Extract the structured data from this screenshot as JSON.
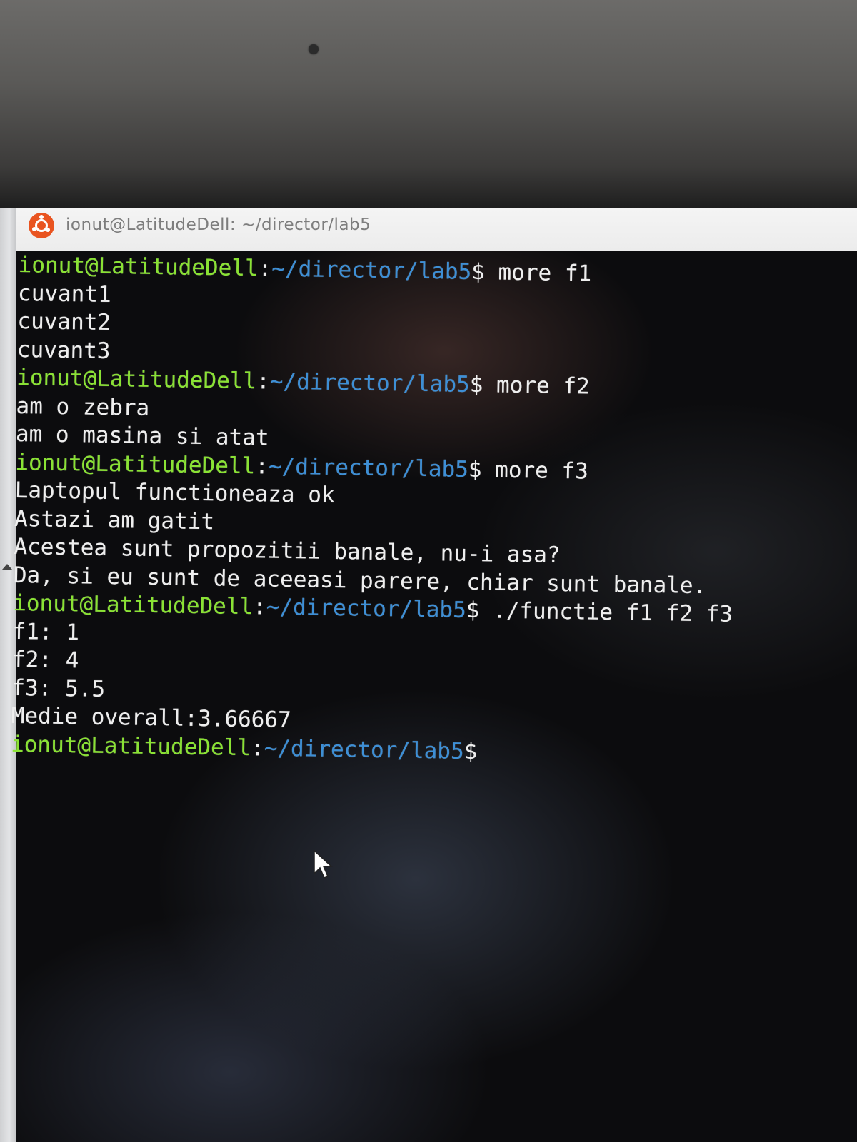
{
  "window": {
    "title": "ionut@LatitudeDell: ~/director/lab5",
    "icon": "ubuntu-icon"
  },
  "prompt": {
    "user_host": "ionut@LatitudeDell",
    "colon": ":",
    "path": "~/director/lab5",
    "dollar": "$"
  },
  "colors": {
    "user_host": "#8ae234",
    "path": "#3d8fd6",
    "output": "#eeeeee"
  },
  "terminal": {
    "lines": [
      {
        "type": "prompt",
        "command": " more f1"
      },
      {
        "type": "output",
        "text": "cuvant1"
      },
      {
        "type": "output",
        "text": "cuvant2"
      },
      {
        "type": "output",
        "text": "cuvant3"
      },
      {
        "type": "prompt",
        "command": " more f2"
      },
      {
        "type": "output",
        "text": "am o zebra"
      },
      {
        "type": "output",
        "text": "am o masina si atat"
      },
      {
        "type": "prompt",
        "command": " more f3"
      },
      {
        "type": "output",
        "text": "Laptopul functioneaza ok"
      },
      {
        "type": "output",
        "text": "Astazi am gatit"
      },
      {
        "type": "output",
        "text": "Acestea sunt propozitii banale, nu-i asa?"
      },
      {
        "type": "output",
        "text": "Da, si eu sunt de aceeasi parere, chiar sunt banale."
      },
      {
        "type": "prompt",
        "command": " ./functie f1 f2 f3"
      },
      {
        "type": "output",
        "text": "f1: 1"
      },
      {
        "type": "output",
        "text": "f2: 4"
      },
      {
        "type": "output",
        "text": "f3: 5.5"
      },
      {
        "type": "output",
        "text": "Medie overall:3.66667"
      },
      {
        "type": "prompt",
        "command": ""
      }
    ]
  }
}
